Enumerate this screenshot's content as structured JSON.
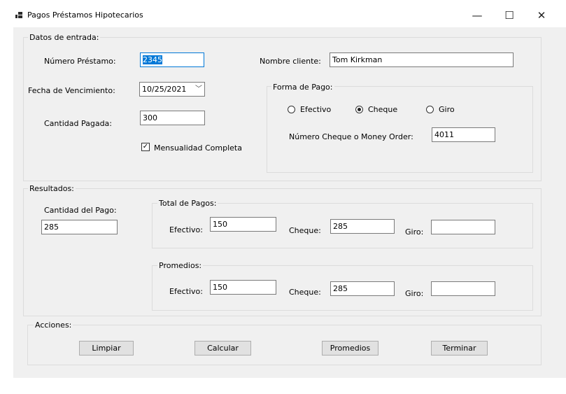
{
  "window": {
    "title": "Pagos Préstamos Hipotecarios",
    "controls": {
      "minimize": "—",
      "maximize": "☐",
      "close": "✕"
    }
  },
  "entrada": {
    "legend": "Datos de entrada:",
    "numero_prestamo": {
      "label": "Número Préstamo:",
      "value": "2345"
    },
    "nombre_cliente": {
      "label": "Nombre cliente:",
      "value": "Tom Kirkman"
    },
    "fecha_vencimiento": {
      "label": "Fecha de Vencimiento:",
      "value": "10/25/2021"
    },
    "cantidad_pagada": {
      "label": "Cantidad Pagada:",
      "value": "300"
    },
    "mensualidad": {
      "label": "Mensualidad Completa",
      "checked": true
    },
    "forma_pago": {
      "legend": "Forma de Pago:",
      "options": [
        "Efectivo",
        "Cheque",
        "Giro"
      ],
      "selected": "Cheque",
      "numero_cheque": {
        "label": "Número Cheque o Money Order:",
        "value": "4011"
      }
    }
  },
  "resultados": {
    "legend": "Resultados:",
    "cantidad_pago": {
      "label": "Cantidad del Pago:",
      "value": "285"
    },
    "total_pagos": {
      "legend": "Total de Pagos:",
      "efectivo_label": "Efectivo:",
      "efectivo": "150",
      "cheque_label": "Cheque:",
      "cheque": "285",
      "giro_label": "Giro:",
      "giro": ""
    },
    "promedios": {
      "legend": "Promedios:",
      "efectivo_label": "Efectivo:",
      "efectivo": "150",
      "cheque_label": "Cheque:",
      "cheque": "285",
      "giro_label": "Giro:",
      "giro": ""
    }
  },
  "acciones": {
    "legend": "Acciones:",
    "limpiar": "Limpiar",
    "calcular": "Calcular",
    "promedios": "Promedios",
    "terminar": "Terminar"
  }
}
